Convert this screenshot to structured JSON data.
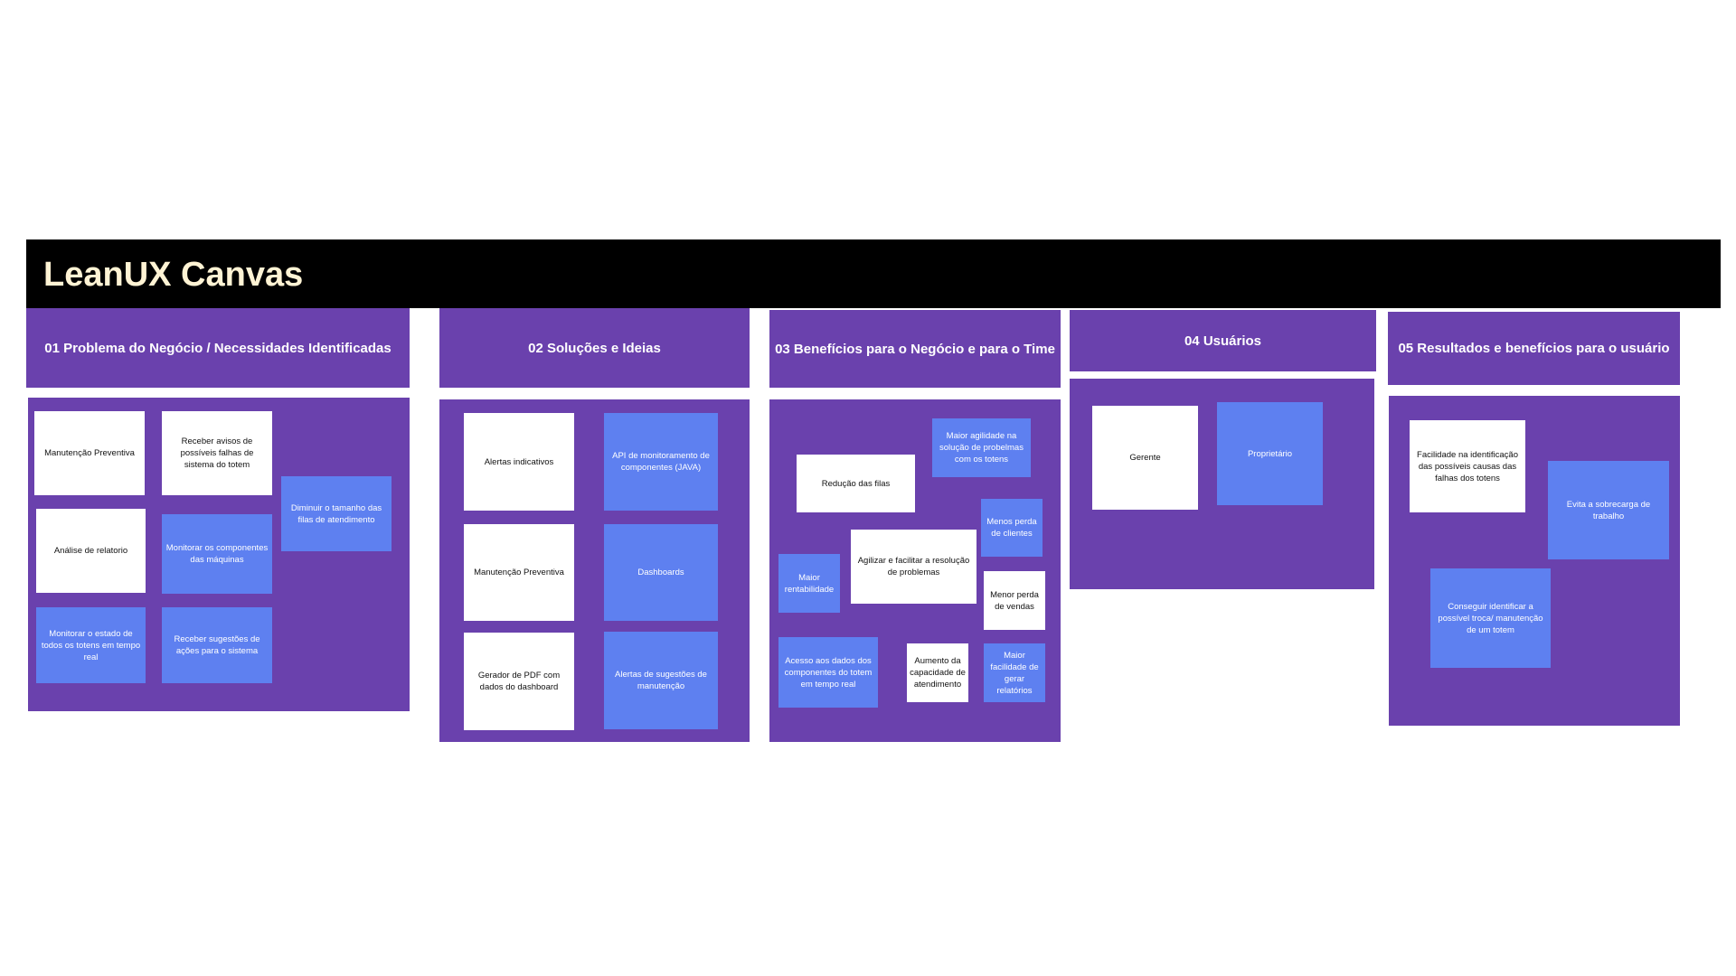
{
  "title": "LeanUX Canvas",
  "colors": {
    "section_purple": "#6a41ad",
    "sticky_blue": "#5e80f0",
    "sticky_white": "#ffffff",
    "banner_black": "#000000",
    "title_cream": "#fff3d4"
  },
  "sections": [
    {
      "title": "01 Problema do Negócio / Necessidades Identificadas",
      "notes": [
        {
          "text": "Manutenção Preventiva",
          "color": "white"
        },
        {
          "text": "Receber avisos de possíveis falhas de sistema do totem",
          "color": "white"
        },
        {
          "text": "Análise de relatorio",
          "color": "white"
        },
        {
          "text": "Monitorar os componentes das máquinas",
          "color": "blue"
        },
        {
          "text": "Diminuir o tamanho das filas de atendimento",
          "color": "blue"
        },
        {
          "text": "Monitorar o estado de todos os totens em tempo real",
          "color": "blue"
        },
        {
          "text": "Receber sugestões de ações para o sistema",
          "color": "blue"
        }
      ]
    },
    {
      "title": "02 Soluções e Ideias",
      "notes": [
        {
          "text": "Alertas indicativos",
          "color": "white"
        },
        {
          "text": "API de monitoramento de componentes (JAVA)",
          "color": "blue"
        },
        {
          "text": "Manutenção Preventiva",
          "color": "white"
        },
        {
          "text": "Dashboards",
          "color": "blue"
        },
        {
          "text": "Gerador de PDF com dados do dashboard",
          "color": "white"
        },
        {
          "text": "Alertas de sugestões de manutenção",
          "color": "blue"
        }
      ]
    },
    {
      "title": "03 Benefícios para o Negócio e para o Time",
      "notes": [
        {
          "text": "Maior agilidade na solução de probelmas com os totens",
          "color": "blue"
        },
        {
          "text": "Redução das filas",
          "color": "white"
        },
        {
          "text": "Menos perda de clientes",
          "color": "blue"
        },
        {
          "text": "Agilizar e facilitar a resolução de problemas",
          "color": "white"
        },
        {
          "text": "Maior rentabilidade",
          "color": "blue"
        },
        {
          "text": "Menor perda de vendas",
          "color": "white"
        },
        {
          "text": "Acesso aos dados dos componentes do totem em tempo real",
          "color": "blue"
        },
        {
          "text": "Aumento da capacidade de atendimento",
          "color": "white"
        },
        {
          "text": "Maior facilidade de gerar relatórios",
          "color": "blue"
        }
      ]
    },
    {
      "title": "04 Usuários",
      "notes": [
        {
          "text": "Gerente",
          "color": "white"
        },
        {
          "text": "Proprietário",
          "color": "blue"
        }
      ]
    },
    {
      "title": "05 Resultados e benefícios para o usuário",
      "notes": [
        {
          "text": "Facilidade na identificação das possíveis causas das falhas dos totens",
          "color": "white"
        },
        {
          "text": "Evita a sobrecarga de trabalho",
          "color": "blue"
        },
        {
          "text": "Conseguir identificar a possível troca/ manutenção de um totem",
          "color": "blue"
        }
      ]
    }
  ]
}
